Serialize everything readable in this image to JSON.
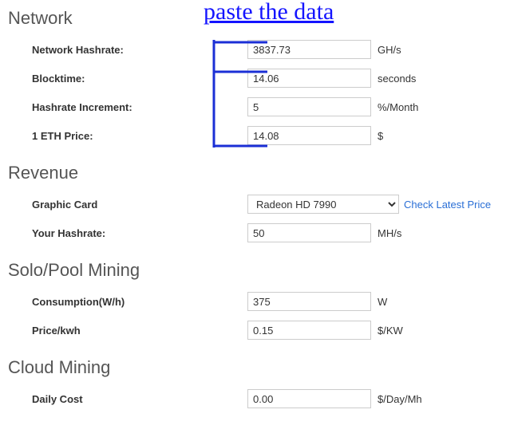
{
  "annotation": {
    "title": "paste the data"
  },
  "network": {
    "heading": "Network",
    "hashrate": {
      "label": "Network Hashrate:",
      "value": "3837.73",
      "unit": "GH/s"
    },
    "blocktime": {
      "label": "Blocktime:",
      "value": "14.06",
      "unit": "seconds"
    },
    "increment": {
      "label": "Hashrate Increment:",
      "value": "5",
      "unit": "%/Month"
    },
    "price": {
      "label": "1 ETH Price:",
      "value": "14.08",
      "unit": "$"
    }
  },
  "revenue": {
    "heading": "Revenue",
    "card": {
      "label": "Graphic Card",
      "selected": "Radeon HD 7990",
      "link_text": "Check Latest Price"
    },
    "hashrate": {
      "label": "Your Hashrate:",
      "value": "50",
      "unit": "MH/s"
    }
  },
  "solo": {
    "heading": "Solo/Pool Mining",
    "consumption": {
      "label": "Consumption(W/h)",
      "value": "375",
      "unit": "W"
    },
    "pricekwh": {
      "label": "Price/kwh",
      "value": "0.15",
      "unit": "$/KW"
    }
  },
  "cloud": {
    "heading": "Cloud Mining",
    "daily": {
      "label": "Daily Cost",
      "value": "0.00",
      "unit": "$/Day/Mh"
    }
  }
}
